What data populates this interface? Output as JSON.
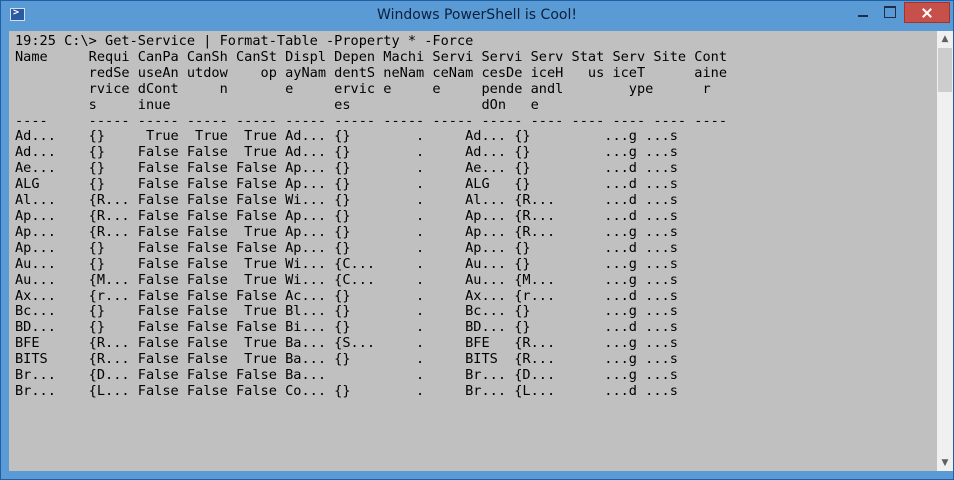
{
  "window": {
    "title": "Windows PowerShell is Cool!"
  },
  "colors": {
    "title_bar": "#5b9bd5",
    "console_bg": "#c0c0c0",
    "console_text": "#000000",
    "close_button": "#c7504a"
  },
  "icons": {
    "app": "powershell-icon",
    "minimize": "minimize-icon",
    "maximize": "maximize-icon",
    "close": "close-icon",
    "scroll_up": "chevron-up-icon",
    "scroll_down": "chevron-down-icon"
  },
  "console": {
    "prompt": "19:25 C:\\> Get-Service | Format-Table -Property * -Force",
    "header_lines": [
      "Name     Requi CanPa CanSh CanSt Displ Depen Machi Servi Servi Serv Stat Serv Site Cont",
      "         redSe useAn utdow    op ayNam dentS neNam ceNam cesDe iceH   us iceT      aine",
      "         rvice dCont     n       e     ervic e     e     pende andl        ype      r",
      "         s     inue                    es                dOn   e",
      "----     ----- ----- ----- ----- ----- ----- ----- ----- ----- ---- ---- ---- ---- ----"
    ],
    "rows": [
      "Ad...    {}     True  True  True Ad... {}        .     Ad... {}         ...g ...s",
      "Ad...    {}    False False  True Ad... {}        .     Ad... {}         ...g ...s",
      "Ae...    {}    False False False Ap... {}        .     Ae... {}         ...d ...s",
      "ALG      {}    False False False Ap... {}        .     ALG   {}         ...d ...s",
      "Al...    {R... False False False Wi... {}        .     Al... {R...      ...d ...s",
      "Ap...    {R... False False False Ap... {}        .     Ap... {R...      ...d ...s",
      "Ap...    {R... False False  True Ap... {}        .     Ap... {R...      ...g ...s",
      "Ap...    {}    False False False Ap... {}        .     Ap... {}         ...d ...s",
      "Au...    {}    False False  True Wi... {C...     .     Au... {}         ...g ...s",
      "Au...    {M... False False  True Wi... {C...     .     Au... {M...      ...g ...s",
      "Ax...    {r... False False False Ac... {}        .     Ax... {r...      ...d ...s",
      "Bc...    {}    False False  True Bl... {}        .     Bc... {}         ...g ...s",
      "BD...    {}    False False False Bi... {}        .     BD... {}         ...d ...s",
      "BFE      {R... False False  True Ba... {S...     .     BFE   {R...      ...g ...s",
      "BITS     {R... False False  True Ba... {}        .     BITS  {R...      ...g ...s",
      "Br...    {D... False False False Ba...           .     Br... {D...      ...g ...s",
      "Br...    {L... False False False Co... {}        .     Br... {L...      ...d ...s"
    ]
  }
}
